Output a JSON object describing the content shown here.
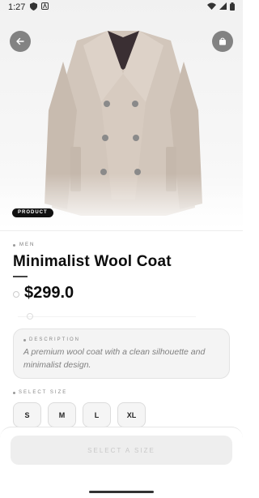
{
  "status_bar": {
    "time": "1:27",
    "icons": [
      "shield-icon",
      "notification-a-icon"
    ],
    "right_icons": [
      "wifi-icon",
      "signal-icon",
      "battery-icon"
    ]
  },
  "hero": {
    "image": "wool-coat-photo",
    "badge": "PRODUCT"
  },
  "product": {
    "category": "MEN",
    "title": "Minimalist Wool Coat",
    "price": "$299.0"
  },
  "description": {
    "label": "DESCRIPTION",
    "text": "A premium wool coat with a clean silhouette and minimalist design."
  },
  "sizes": {
    "label": "SELECT SIZE",
    "options": [
      "S",
      "M",
      "L",
      "XL"
    ]
  },
  "cta": {
    "label": "SELECT A SIZE"
  },
  "colors": {
    "accent": "#111111",
    "coat": "#cfc3b8",
    "card_bg": "#f4f4f4"
  }
}
